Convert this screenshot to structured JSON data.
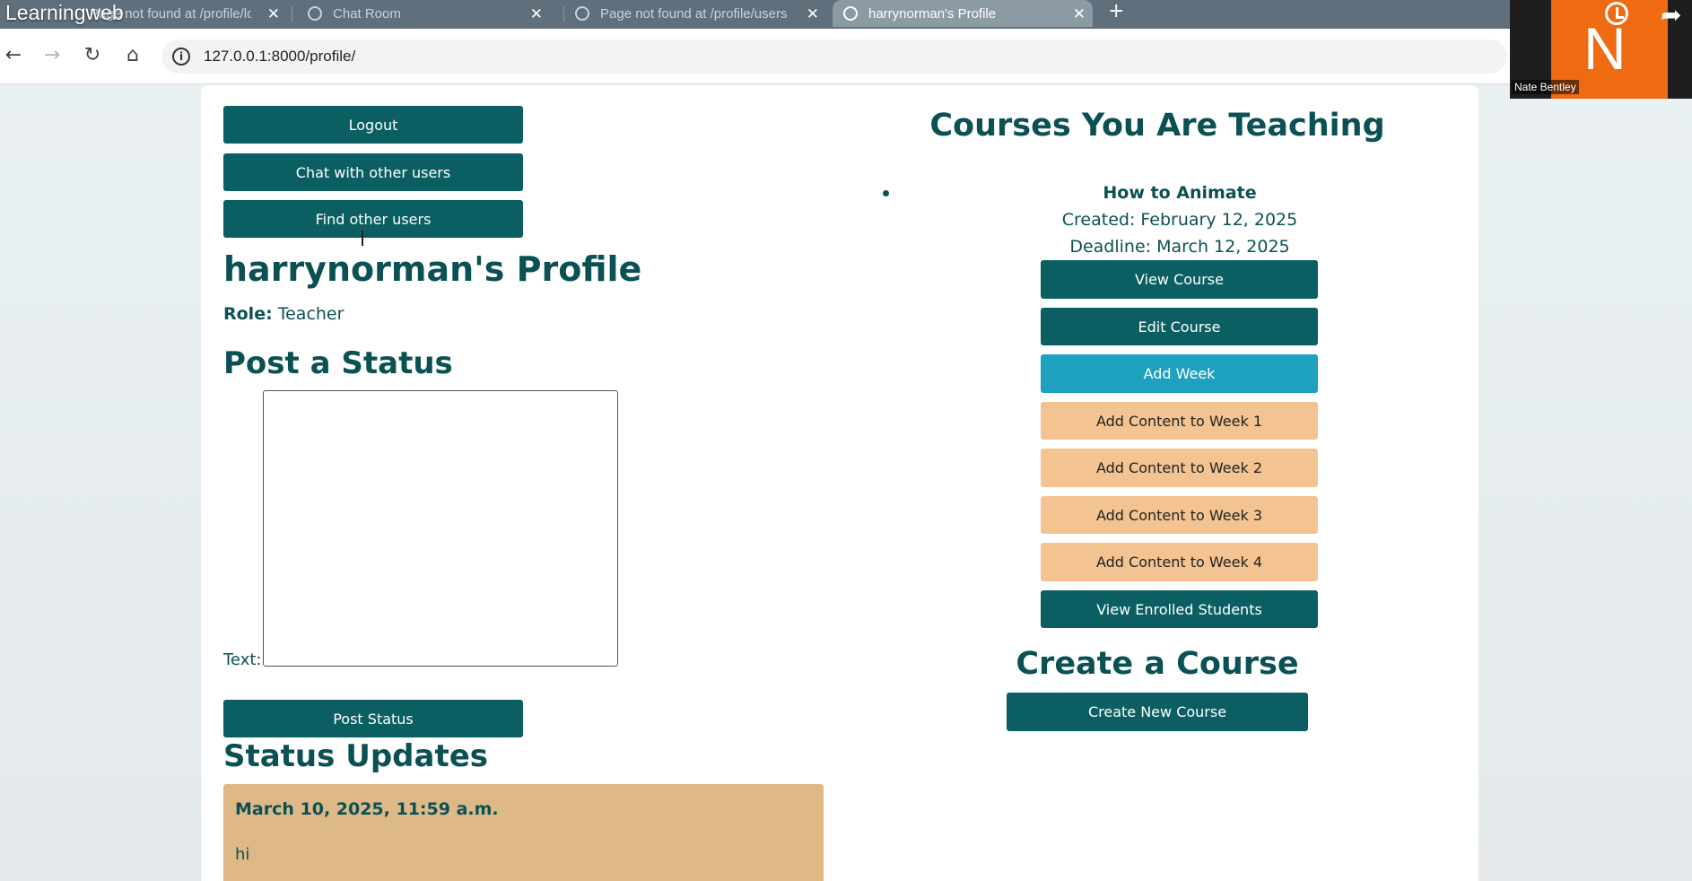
{
  "video": {
    "title": "Learningweb"
  },
  "tabs": [
    {
      "title": "Page not found at /profile/logout",
      "active": false
    },
    {
      "title": "Chat Room",
      "active": false
    },
    {
      "title": "Page not found at /profile/users",
      "active": false
    },
    {
      "title": "harrynorman's Profile",
      "active": true
    }
  ],
  "new_tab_label": "+",
  "address_bar": {
    "url": "127.0.0.1:8000/profile/"
  },
  "webcam": {
    "initial": "N",
    "name": "Nate Bentley"
  },
  "left": {
    "logout_label": "Logout",
    "chat_label": "Chat with other users",
    "find_label": "Find other users",
    "profile_title": "harrynorman's Profile",
    "role_key": "Role:",
    "role_value": "Teacher",
    "post_heading": "Post a Status",
    "text_label": "Text:",
    "post_button": "Post Status",
    "updates_heading": "Status Updates",
    "status_updates": [
      {
        "date": "March 10, 2025, 11:59 a.m.",
        "text": "hi"
      }
    ]
  },
  "right": {
    "teaching_heading": "Courses You Are Teaching",
    "course": {
      "title": "How to Animate",
      "created": "Created: February 12, 2025",
      "deadline": "Deadline: March 12, 2025",
      "actions": {
        "view": "View Course",
        "edit": "Edit Course",
        "add_week": "Add Week",
        "week1": "Add Content to Week 1",
        "week2": "Add Content to Week 2",
        "week3": "Add Content to Week 3",
        "week4": "Add Content to Week 4",
        "students": "View Enrolled Students"
      }
    },
    "create_heading": "Create a Course",
    "create_button": "Create New Course"
  },
  "colors": {
    "primary": "#0b5f63",
    "heading": "#0b5154",
    "accent_teal": "#1ea0bf",
    "week_tan": "#f3c491",
    "status_card": "#deb887"
  }
}
